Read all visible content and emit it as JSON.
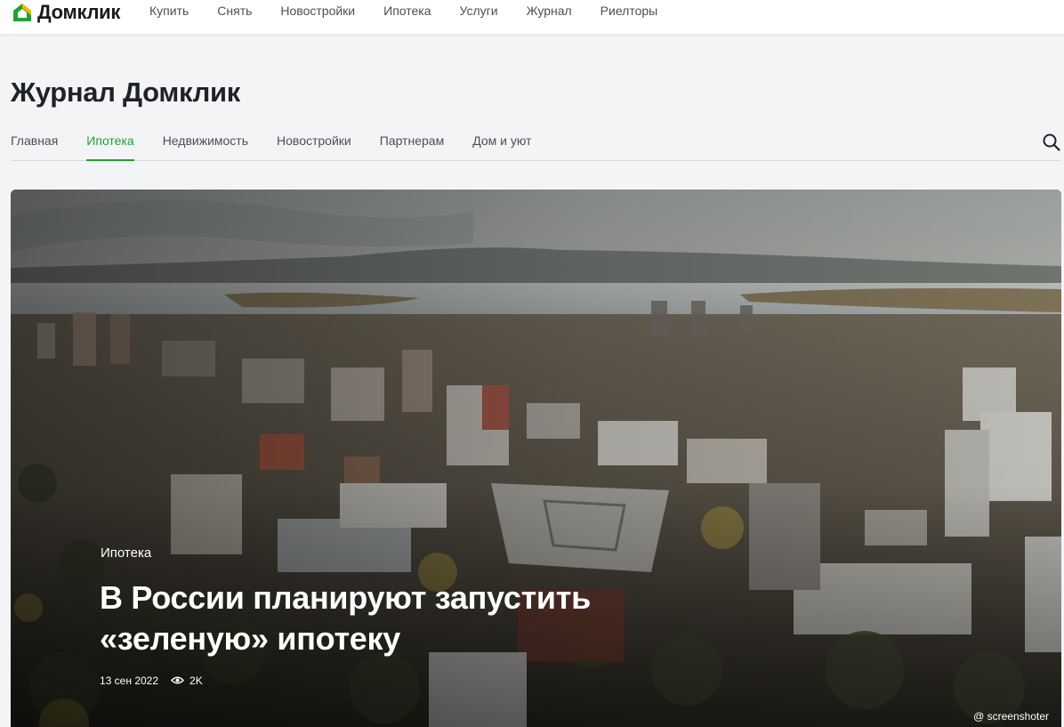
{
  "brand": {
    "logo_text": "Домклик",
    "accent": "#21a038"
  },
  "topnav": {
    "items": [
      "Купить",
      "Снять",
      "Новостройки",
      "Ипотека",
      "Услуги",
      "Журнал",
      "Риелторы"
    ]
  },
  "journal": {
    "title": "Журнал Домклик",
    "tabs": [
      "Главная",
      "Ипотека",
      "Недвижимость",
      "Новостройки",
      "Партнерам",
      "Дом и уют"
    ],
    "active_tab": "Ипотека",
    "search_icon": "search-icon"
  },
  "hero": {
    "category": "Ипотека",
    "title": "В России планируют запустить «зеленую» ипотеку",
    "date": "13 сен 2022",
    "views": "2K",
    "views_icon": "eye-icon",
    "watermark": "@ screenshoter"
  }
}
